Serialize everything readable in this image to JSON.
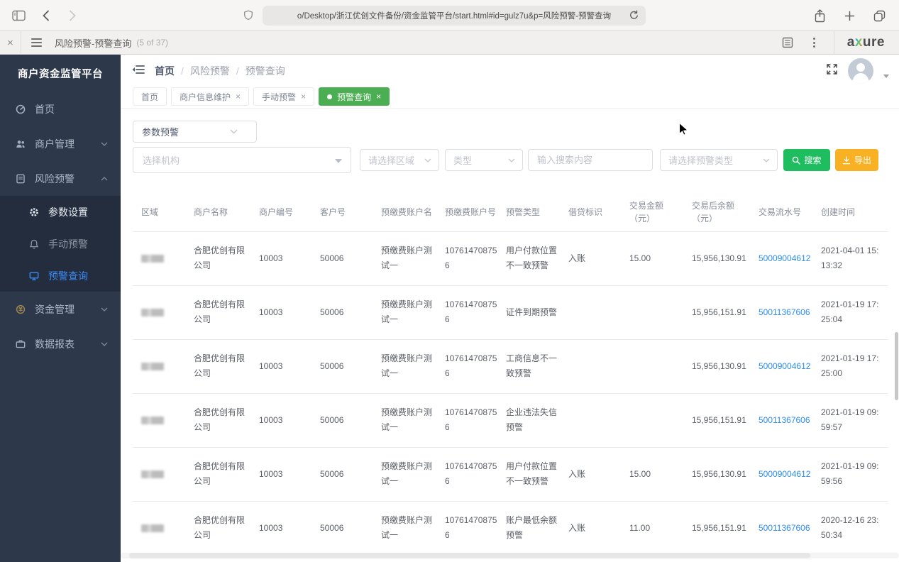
{
  "browser": {
    "url": "o/Desktop/浙江优创文件备份/资金监管平台/start.html#id=gulz7u&p=风险预警-预警查询"
  },
  "axure": {
    "title": "风险预警-预警查询",
    "page_count": "(5 of 37)",
    "logo_a": "a",
    "logo_x": "x",
    "logo_ure": "ure"
  },
  "ui": {
    "close_glyph": "×"
  },
  "icons": {
    "browser": [
      "sidebar-panel",
      "back-arrow",
      "forward-arrow",
      "shield",
      "reload",
      "share",
      "new-tab-plus",
      "tab-overview"
    ],
    "axure_bar": [
      "console-page",
      "kebab-menu"
    ],
    "sidebar": [
      "dashboard",
      "users",
      "document",
      "gear",
      "bell",
      "monitor",
      "coin",
      "briefcase",
      "chevron"
    ],
    "header": [
      "menu-fold",
      "fullscreen",
      "avatar"
    ],
    "buttons": [
      "search-magnifier",
      "export-download"
    ]
  },
  "colors": {
    "sidebar_bg": "#2d384b",
    "sidebar_sub_bg": "#232d3d",
    "active_blue": "#3d8af5",
    "tab_green": "#4cae52",
    "search_green": "#1ebe60",
    "export_amber": "#f8b123",
    "link_blue": "#2d8cf0"
  },
  "sidebar": {
    "title": "商户资金监管平台",
    "items": [
      {
        "label": "首页"
      },
      {
        "label": "商户管理"
      },
      {
        "label": "风险预警"
      },
      {
        "label": "参数设置"
      },
      {
        "label": "手动预警"
      },
      {
        "label": "预警查询"
      },
      {
        "label": "资金管理"
      },
      {
        "label": "数据报表"
      }
    ]
  },
  "breadcrumb": {
    "items": [
      "首页",
      "风险预警",
      "预警查询"
    ],
    "separator": "/"
  },
  "tabs": [
    {
      "label": "首页"
    },
    {
      "label": "商户信息维护"
    },
    {
      "label": "手动预警"
    },
    {
      "label": "预警查询"
    }
  ],
  "filters": {
    "warn_mode_value": "参数预警",
    "org_placeholder": "选择机构",
    "region_placeholder": "请选择区域",
    "type_placeholder": "类型",
    "search_placeholder": "输入搜索内容",
    "warning_type_placeholder": "请选择预警类型",
    "search_button": "搜索",
    "export_button": "导出"
  },
  "table": {
    "region_masked": true,
    "columns": [
      "区域",
      "商户名称",
      "商户编号",
      "客户号",
      "预缴费账户名",
      "预缴费账户号",
      "预警类型",
      "借贷标识",
      "交易金额（元）",
      "交易后余额（元）",
      "交易流水号",
      "创建时间"
    ],
    "rows": [
      {
        "merchant": "合肥优创有限公司",
        "merchant_no": "10003",
        "customer_no": "50006",
        "account_name": "预缴费账户测试一",
        "account_no": "107614708756",
        "warning_type": "用户付款位置不一致预警",
        "debit_flag": "入账",
        "amount": "15.00",
        "balance": "15,956,130.91",
        "serial": "50009004612",
        "created": "2021-04-01 15:13:32"
      },
      {
        "merchant": "合肥优创有限公司",
        "merchant_no": "10003",
        "customer_no": "50006",
        "account_name": "预缴费账户测试一",
        "account_no": "107614708756",
        "warning_type": "证件到期预警",
        "debit_flag": "",
        "amount": "",
        "balance": "15,956,151.91",
        "serial": "50011367606",
        "created": "2021-01-19 17:25:04"
      },
      {
        "merchant": "合肥优创有限公司",
        "merchant_no": "10003",
        "customer_no": "50006",
        "account_name": "预缴费账户测试一",
        "account_no": "107614708756",
        "warning_type": "工商信息不一致预警",
        "debit_flag": "",
        "amount": "",
        "balance": "15,956,130.91",
        "serial": "50009004612",
        "created": "2021-01-19 17:25:00"
      },
      {
        "merchant": "合肥优创有限公司",
        "merchant_no": "10003",
        "customer_no": "50006",
        "account_name": "预缴费账户测试一",
        "account_no": "107614708756",
        "warning_type": "企业违法失信预警",
        "debit_flag": "",
        "amount": "",
        "balance": "15,956,151.91",
        "serial": "50011367606",
        "created": "2021-01-19 09:59:57"
      },
      {
        "merchant": "合肥优创有限公司",
        "merchant_no": "10003",
        "customer_no": "50006",
        "account_name": "预缴费账户测试一",
        "account_no": "107614708756",
        "warning_type": "用户付款位置不一致预警",
        "debit_flag": "入账",
        "amount": "15.00",
        "balance": "15,956,130.91",
        "serial": "50009004612",
        "created": "2021-01-19 09:59:56"
      },
      {
        "merchant": "合肥优创有限公司",
        "merchant_no": "10003",
        "customer_no": "50006",
        "account_name": "预缴费账户测试一",
        "account_no": "107614708756",
        "warning_type": "账户最低余额预警",
        "debit_flag": "入账",
        "amount": "11.00",
        "balance": "15,956,151.91",
        "serial": "50011367606",
        "created": "2020-12-16 23:50:34"
      }
    ]
  }
}
